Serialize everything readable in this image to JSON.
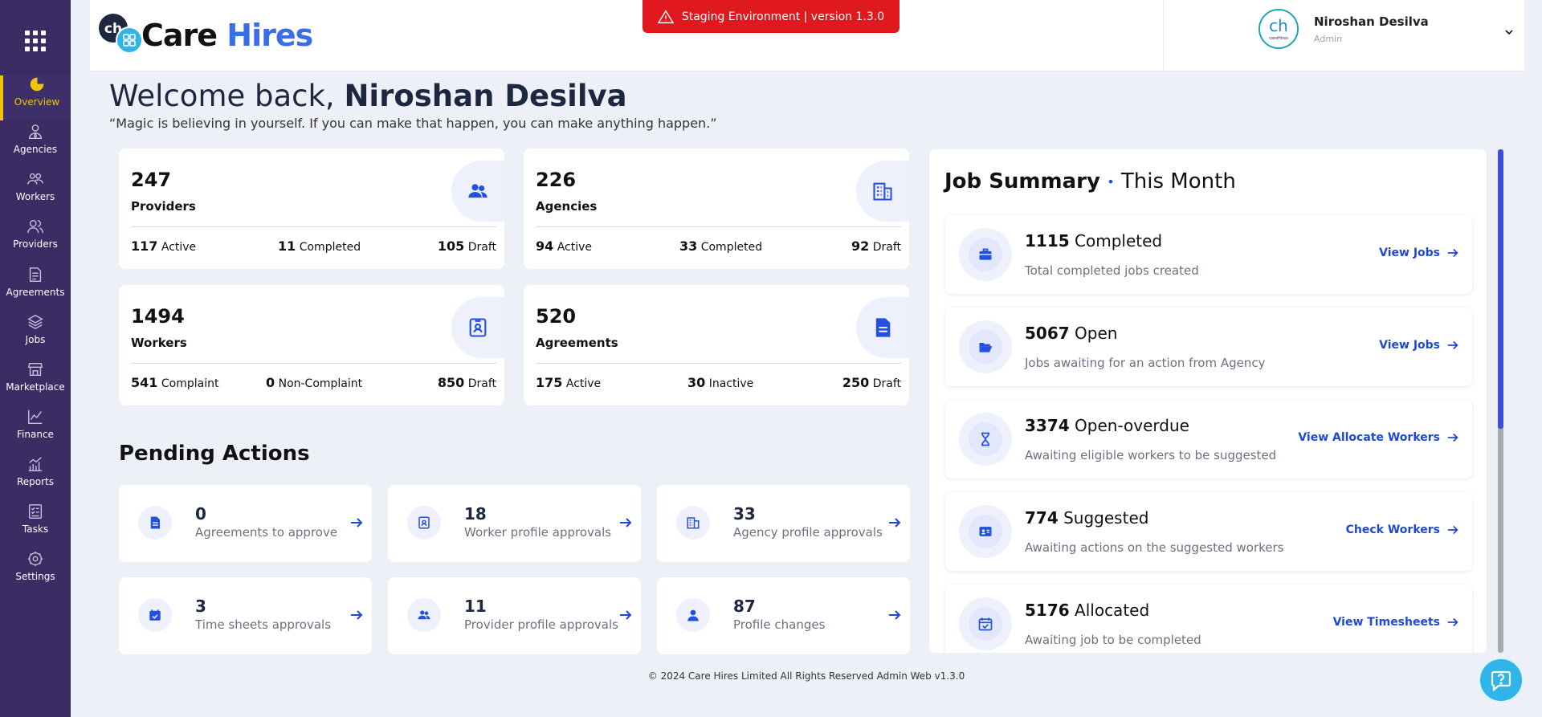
{
  "sidebar": {
    "items": [
      {
        "label": "Overview",
        "icon": "pie-chart-icon"
      },
      {
        "label": "Agencies",
        "icon": "user-tie-icon"
      },
      {
        "label": "Workers",
        "icon": "users-icon"
      },
      {
        "label": "Providers",
        "icon": "users-pair-icon"
      },
      {
        "label": "Agreements",
        "icon": "document-edit-icon"
      },
      {
        "label": "Jobs",
        "icon": "layers-icon"
      },
      {
        "label": "Marketplace",
        "icon": "store-icon"
      },
      {
        "label": "Finance",
        "icon": "chart-line-icon"
      },
      {
        "label": "Reports",
        "icon": "bar-chart-icon"
      },
      {
        "label": "Tasks",
        "icon": "checklist-icon"
      },
      {
        "label": "Settings",
        "icon": "gear-icon"
      }
    ],
    "active": "Overview"
  },
  "header": {
    "logo_word1": "Care",
    "logo_word2": "Hires",
    "staging_text": "Staging Environment | version 1.3.0",
    "user_name": "Niroshan Desilva",
    "user_role": "Admin",
    "avatar_text": "careHires"
  },
  "welcome": {
    "greeting": "Welcome back, ",
    "name": "Niroshan Desilva",
    "quote": "“Magic is believing in yourself. If you can make that happen, you can make anything happen.”"
  },
  "stats": [
    {
      "number": "247",
      "label": "Providers",
      "icon": "users-icon",
      "sub": [
        {
          "value": "117",
          "label": "Active"
        },
        {
          "value": "11",
          "label": "Completed"
        },
        {
          "value": "105",
          "label": "Draft"
        }
      ]
    },
    {
      "number": "226",
      "label": "Agencies",
      "icon": "building-icon",
      "sub": [
        {
          "value": "94",
          "label": "Active"
        },
        {
          "value": "33",
          "label": "Completed"
        },
        {
          "value": "92",
          "label": "Draft"
        }
      ]
    },
    {
      "number": "1494",
      "label": "Workers",
      "icon": "id-badge-icon",
      "sub": [
        {
          "value": "541",
          "label": "Complaint"
        },
        {
          "value": "0",
          "label": "Non-Complaint"
        },
        {
          "value": "850",
          "label": "Draft"
        }
      ]
    },
    {
      "number": "520",
      "label": "Agreements",
      "icon": "file-icon",
      "sub": [
        {
          "value": "175",
          "label": "Active"
        },
        {
          "value": "30",
          "label": "Inactive"
        },
        {
          "value": "250",
          "label": "Draft"
        }
      ]
    }
  ],
  "pending": {
    "title": "Pending Actions",
    "items": [
      {
        "number": "0",
        "label": "Agreements to approve",
        "icon": "file-icon"
      },
      {
        "number": "18",
        "label": "Worker profile approvals",
        "icon": "id-badge-icon"
      },
      {
        "number": "33",
        "label": "Agency profile approvals",
        "icon": "building-icon"
      },
      {
        "number": "3",
        "label": "Time sheets approvals",
        "icon": "calendar-check-icon"
      },
      {
        "number": "11",
        "label": "Provider profile approvals",
        "icon": "users-icon"
      },
      {
        "number": "87",
        "label": "Profile changes",
        "icon": "user-icon"
      }
    ]
  },
  "job_summary": {
    "title": "Job Summary",
    "period": "This Month",
    "items": [
      {
        "number": "1115",
        "status": "Completed",
        "desc": "Total completed jobs created",
        "link": "View Jobs",
        "icon": "briefcase-icon"
      },
      {
        "number": "5067",
        "status": "Open",
        "desc": "Jobs awaiting for an action from Agency",
        "link": "View Jobs",
        "icon": "folder-open-icon"
      },
      {
        "number": "3374",
        "status": "Open-overdue",
        "desc": "Awaiting eligible workers to be suggested",
        "link": "View Allocate Workers",
        "icon": "hourglass-icon"
      },
      {
        "number": "774",
        "status": "Suggested",
        "desc": "Awaiting actions on the suggested workers",
        "link": "Check Workers",
        "icon": "id-card-icon"
      },
      {
        "number": "5176",
        "status": "Allocated",
        "desc": "Awaiting job to be completed",
        "link": "View Timesheets",
        "icon": "calendar-check-icon"
      }
    ]
  },
  "footer": {
    "text": "© 2024 Care Hires Limited All Rights Reserved Admin Web v1.3.0"
  },
  "colors": {
    "sidebar_bg": "#3b2c64",
    "active": "#f2c40c",
    "accent": "#1f48d4",
    "brand_blue": "#3a6ee8",
    "staging_red": "#e0191f",
    "page_bg": "#eef0f7"
  }
}
